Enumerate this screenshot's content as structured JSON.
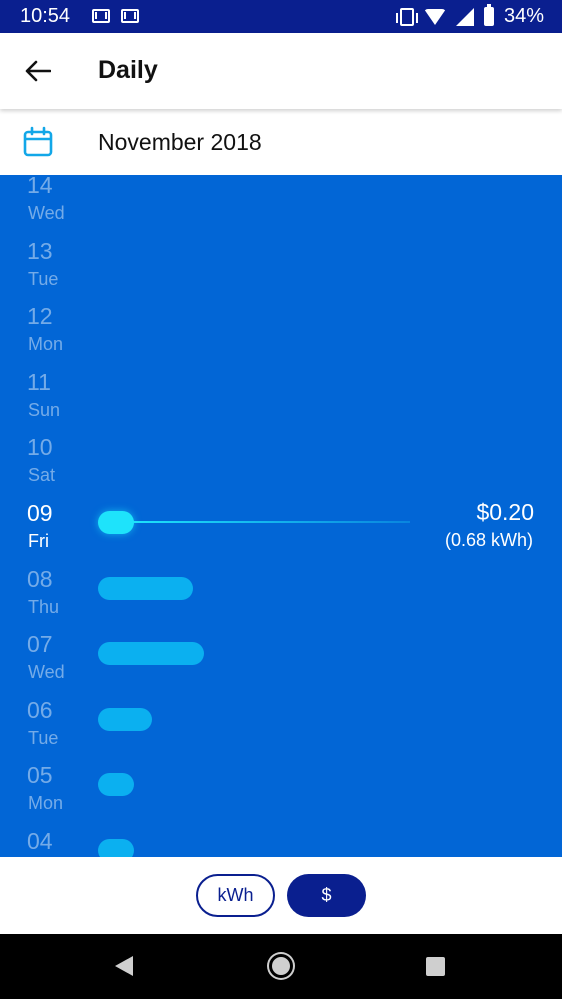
{
  "status_bar": {
    "time": "10:54",
    "battery": "34%"
  },
  "app_bar": {
    "title": "Daily"
  },
  "month_selector": {
    "label": "November 2018"
  },
  "chart_data": {
    "type": "bar",
    "orientation": "horizontal",
    "unit": "$",
    "days": [
      {
        "num": "14",
        "name": "Wed",
        "value": null
      },
      {
        "num": "13",
        "name": "Tue",
        "value": null
      },
      {
        "num": "12",
        "name": "Mon",
        "value": null
      },
      {
        "num": "11",
        "name": "Sun",
        "value": null
      },
      {
        "num": "10",
        "name": "Sat",
        "value": null
      },
      {
        "num": "09",
        "name": "Fri",
        "value": 0.2,
        "selected": true,
        "amount_label": "$0.20",
        "kwh_label": "(0.68 kWh)"
      },
      {
        "num": "08",
        "name": "Thu",
        "value": 0.53
      },
      {
        "num": "07",
        "name": "Wed",
        "value": 0.59
      },
      {
        "num": "06",
        "name": "Tue",
        "value": 0.3
      },
      {
        "num": "05",
        "name": "Mon",
        "value": 0.19
      },
      {
        "num": "04",
        "name": "Sun",
        "value": 0.18
      }
    ]
  },
  "footer": {
    "kwh_label": "kWh",
    "dollar_label": "$",
    "active": "$"
  }
}
